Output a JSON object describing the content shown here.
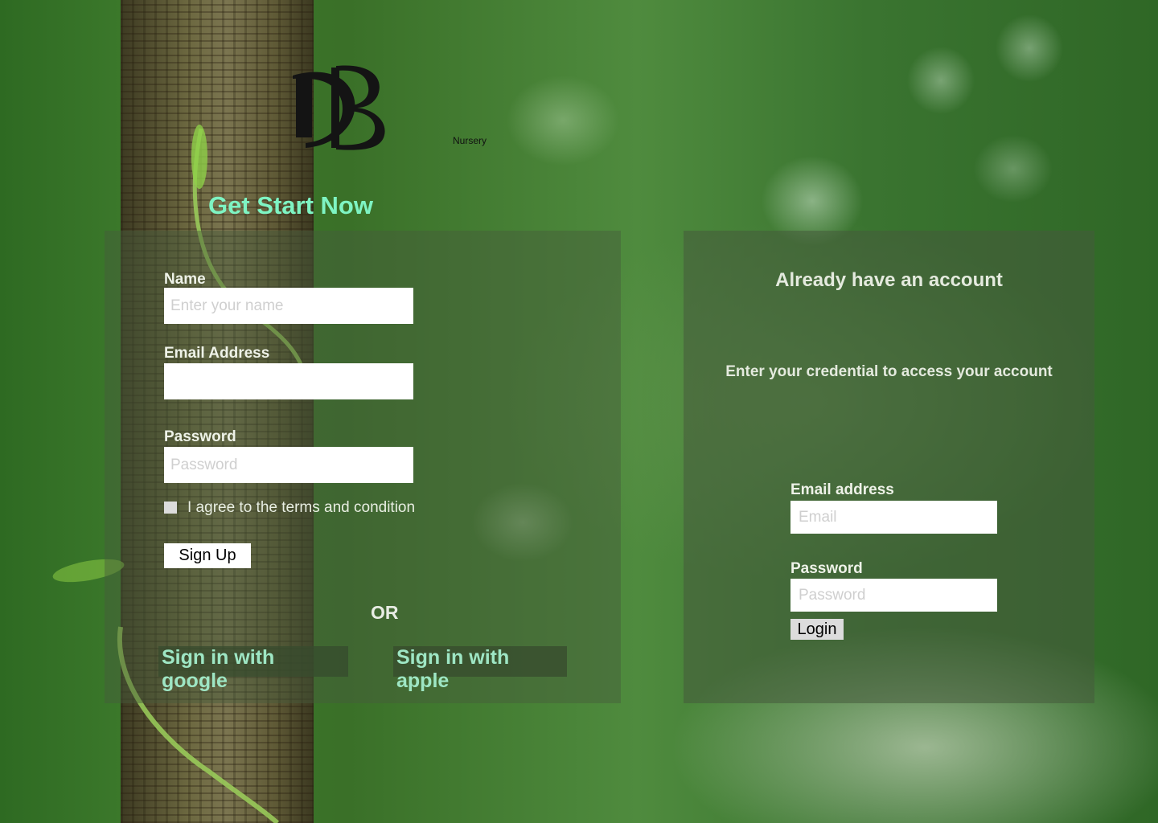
{
  "brand": {
    "logo_letters": "DB",
    "name": "Nursery"
  },
  "signup": {
    "headline": "Get Start Now",
    "name_label": "Name",
    "name_placeholder": "Enter your name",
    "email_label": "Email Address",
    "email_placeholder": "",
    "password_label": "Password",
    "password_placeholder": "Password",
    "agree_text": "I agree to the terms and condition",
    "agree_checked": false,
    "signup_button": "Sign Up",
    "or_text": "OR",
    "google_button": "Sign in with google",
    "apple_button": "Sign in with apple"
  },
  "login": {
    "title": "Already have an account",
    "subtitle": "Enter your credential to access your account",
    "email_label": "Email address",
    "email_placeholder": "Email",
    "password_label": "Password",
    "password_placeholder": "Password",
    "login_button": "Login"
  },
  "colors": {
    "headline": "#7ef4c3",
    "social_text": "#9ee6c4",
    "panel_overlay": "#465a3c"
  }
}
